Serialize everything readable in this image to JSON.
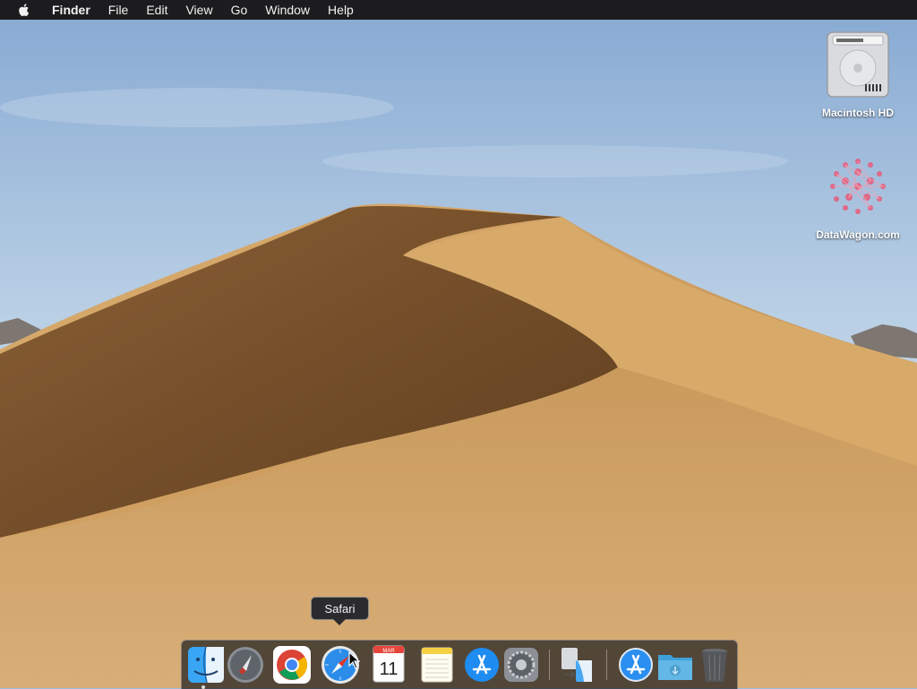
{
  "menubar": {
    "app_name": "Finder",
    "items": [
      "File",
      "Edit",
      "View",
      "Go",
      "Window",
      "Help"
    ]
  },
  "desktop_icons": [
    {
      "label": "Macintosh HD",
      "icon": "hard-drive-icon"
    },
    {
      "label": "DataWagon.com",
      "icon": "datawagon-logo-icon"
    }
  ],
  "dock": {
    "tooltip": "Safari",
    "apps": [
      {
        "name": "Finder",
        "icon": "finder-icon",
        "running": true
      },
      {
        "name": "Launchpad",
        "icon": "launchpad-icon"
      },
      {
        "name": "Google Chrome",
        "icon": "chrome-icon"
      },
      {
        "name": "Safari",
        "icon": "safari-icon"
      },
      {
        "name": "Calendar",
        "icon": "calendar-icon",
        "month": "MAR",
        "day": "11"
      },
      {
        "name": "Notes",
        "icon": "notes-icon"
      },
      {
        "name": "App Store",
        "icon": "app-store-icon"
      },
      {
        "name": "System Preferences",
        "icon": "system-preferences-icon"
      },
      {
        "name": "Migration Assistant",
        "icon": "migration-assistant-icon"
      },
      {
        "name": "Applications",
        "icon": "applications-folder-icon"
      },
      {
        "name": "Downloads",
        "icon": "downloads-folder-icon"
      },
      {
        "name": "Trash",
        "icon": "trash-icon"
      }
    ]
  },
  "colors": {
    "menubar_bg": "#1c1c1e",
    "sky": "#9bbcdc",
    "dune": "#c99a5c",
    "dune_shadow": "#6e4a26"
  }
}
